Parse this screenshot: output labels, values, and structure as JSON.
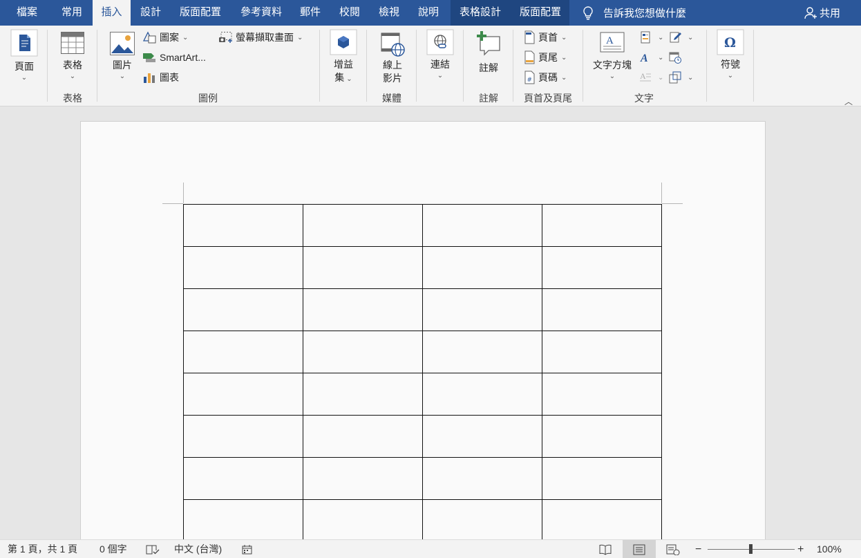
{
  "menubar": {
    "tabs": [
      "檔案",
      "常用",
      "插入",
      "設計",
      "版面配置",
      "參考資料",
      "郵件",
      "校閱",
      "檢視",
      "說明",
      "表格設計",
      "版面配置"
    ],
    "active_tab": "插入",
    "tell_me": "告訴我您想做什麼",
    "share": "共用"
  },
  "ribbon": {
    "page": {
      "label": "頁面"
    },
    "table": {
      "label": "表格",
      "group": "表格"
    },
    "illustrations": {
      "group": "圖例",
      "picture": "圖片",
      "shapes": "圖案",
      "smartart": "SmartArt...",
      "chart": "圖表",
      "screenshot": "螢幕擷取畫面"
    },
    "addins": {
      "label_line1": "增益",
      "label_line2": "集"
    },
    "media": {
      "label_line1": "線上",
      "label_line2": "影片",
      "group": "媒體"
    },
    "links": {
      "label": "連結"
    },
    "comments": {
      "label": "註解",
      "group": "註解"
    },
    "header_footer": {
      "header": "頁首",
      "footer": "頁尾",
      "page_number": "頁碼",
      "group": "頁首及頁尾"
    },
    "text": {
      "textbox": "文字方塊",
      "group": "文字"
    },
    "symbols": {
      "label": "符號"
    }
  },
  "document": {
    "table_rows": 8,
    "table_cols": 4
  },
  "status": {
    "page": "第 1 頁，共 1 頁",
    "words": "0 個字",
    "language": "中文 (台灣)",
    "zoom_minus": "−",
    "zoom_plus": "+",
    "zoom": "100%"
  },
  "colors": {
    "accent": "#2b579a",
    "context_tab": "#1f4680"
  }
}
